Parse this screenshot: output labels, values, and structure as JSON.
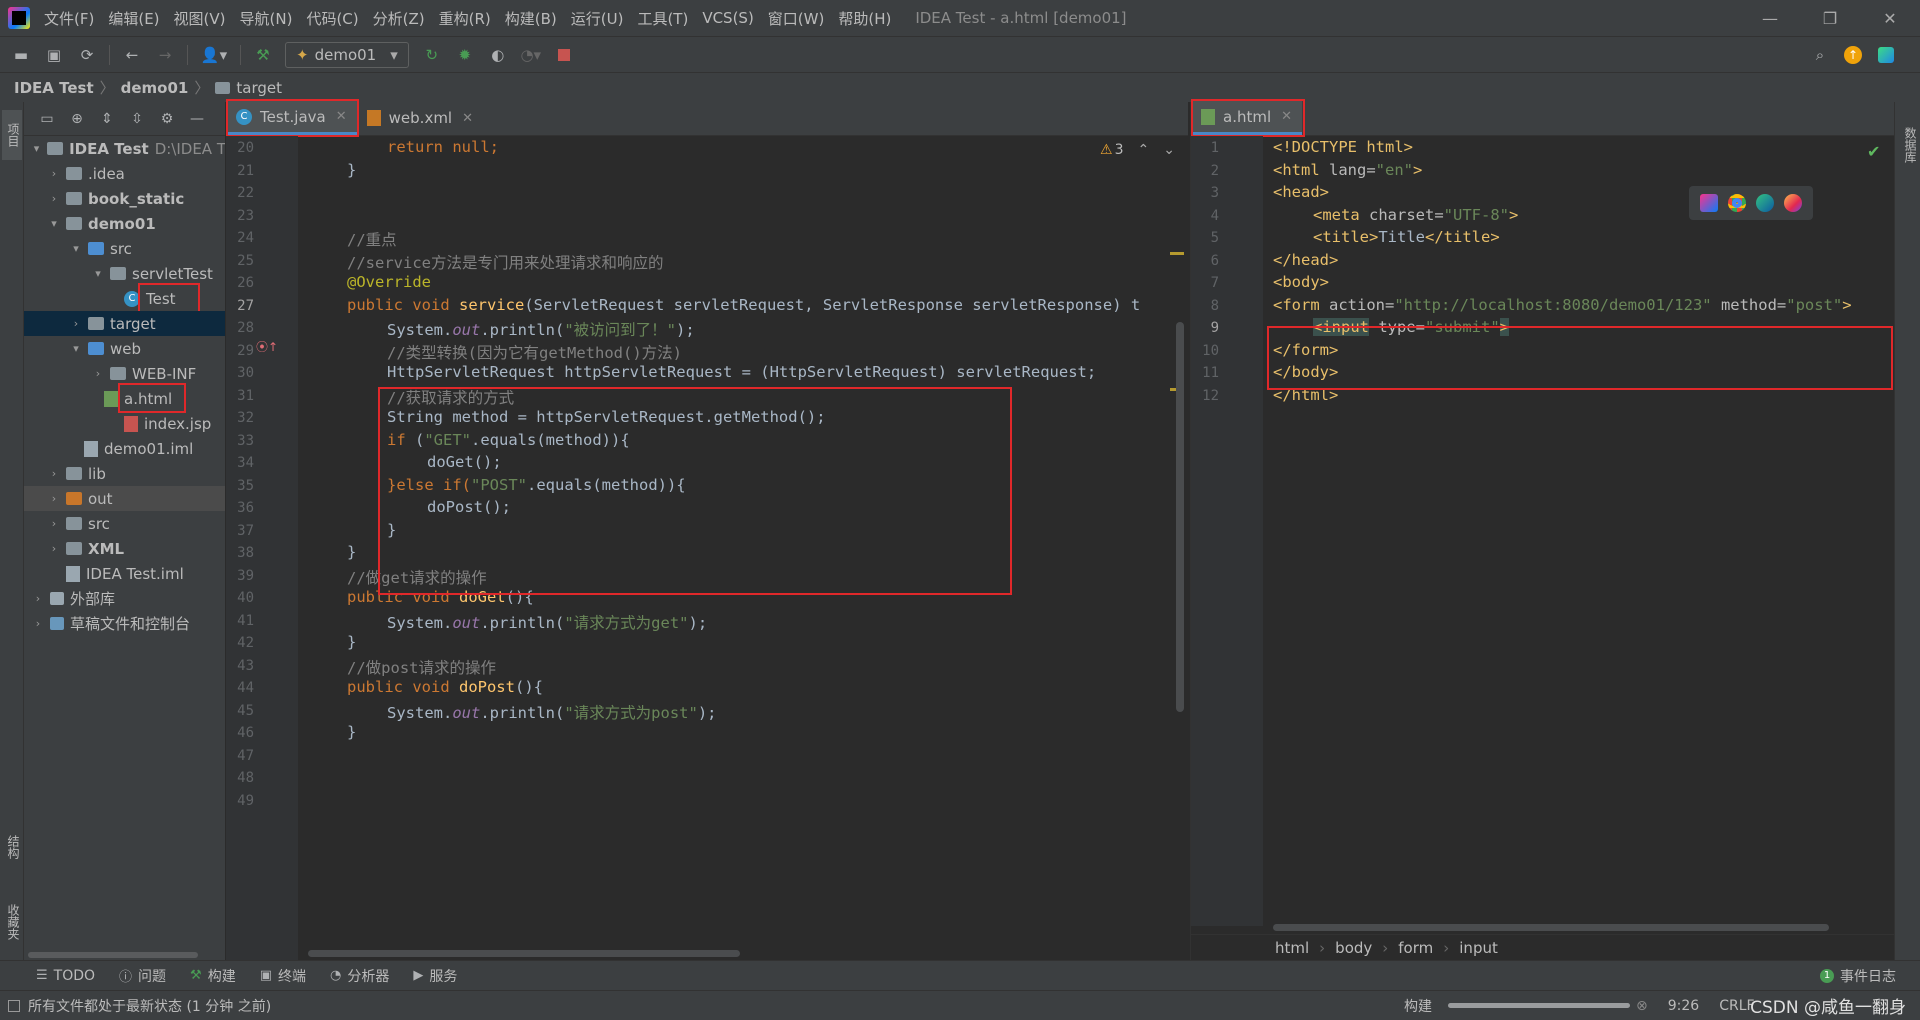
{
  "titlebar": {
    "menu": [
      "文件(F)",
      "编辑(E)",
      "视图(V)",
      "导航(N)",
      "代码(C)",
      "分析(Z)",
      "重构(R)",
      "构建(B)",
      "运行(U)",
      "工具(T)",
      "VCS(S)",
      "窗口(W)",
      "帮助(H)"
    ],
    "window_title": "IDEA Test - a.html [demo01]"
  },
  "toolbar": {
    "run_config": "demo01"
  },
  "breadcrumb": [
    "IDEA Test",
    "demo01",
    "target"
  ],
  "left_stripe": {
    "project": "项目",
    "structure": "结构",
    "favorites": "收藏夹"
  },
  "right_stripe": {
    "database": "数据库"
  },
  "project_tree": [
    {
      "label": "IDEA Test",
      "extra": "D:\\IDEA T",
      "bold": true
    },
    {
      "label": ".idea"
    },
    {
      "label": "book_static",
      "bold": true
    },
    {
      "label": "demo01",
      "bold": true
    },
    {
      "label": "src"
    },
    {
      "label": "servletTest"
    },
    {
      "label": "Test"
    },
    {
      "label": "target"
    },
    {
      "label": "web"
    },
    {
      "label": "WEB-INF"
    },
    {
      "label": "a.html"
    },
    {
      "label": "index.jsp"
    },
    {
      "label": "demo01.iml"
    },
    {
      "label": "lib"
    },
    {
      "label": "out"
    },
    {
      "label": "src"
    },
    {
      "label": "XML",
      "bold": true
    },
    {
      "label": "IDEA Test.iml"
    },
    {
      "label": "外部库"
    },
    {
      "label": "草稿文件和控制台"
    }
  ],
  "left_editor": {
    "tabs": [
      "Test.java",
      "web.xml"
    ],
    "inspection": "3",
    "line_numbers": [
      "20",
      "21",
      "22",
      "23",
      "24",
      "25",
      "26",
      "27",
      "28",
      "29",
      "30",
      "31",
      "32",
      "33",
      "34",
      "35",
      "36",
      "37",
      "38",
      "39",
      "40",
      "41",
      "42",
      "43",
      "44",
      "45",
      "46",
      "47",
      "48",
      "49"
    ],
    "code": {
      "l20": "return null;",
      "l21": "}",
      "l24": "//重点",
      "l25": "//service方法是专门用来处理请求和响应的",
      "l26": "@Override",
      "l27_kw": "public void ",
      "l27_fn": "service",
      "l27_rest": "(ServletRequest servletRequest, ServletResponse servletResponse) t",
      "l28_a": "System.",
      "l28_b": "out",
      "l28_c": ".println(",
      "l28_str": "\"被访问到了！\"",
      "l28_d": ");",
      "l29": "//类型转换(因为它有getMethod()方法)",
      "l30": "HttpServletRequest httpServletRequest = (HttpServletRequest) servletRequest;",
      "l31": "//获取请求的方式",
      "l32": "String method = httpServletRequest.getMethod();",
      "l33_kw": "if ",
      "l33_str": "\"GET\"",
      "l33_rest": ".equals(method)){",
      "l34": "doGet();",
      "l35_kw": "}else if(",
      "l35_str": "\"POST\"",
      "l35_rest": ".equals(method)){",
      "l36": "doPost();",
      "l37": "}",
      "l38": "}",
      "l39": "//做get请求的操作",
      "l40_fn": "doGet",
      "l41_str": "\"请求方式为get\"",
      "l42": "}",
      "l43": "//做post请求的操作",
      "l44_fn": "doPost",
      "l45_str": "\"请求方式为post\"",
      "l46": "}"
    }
  },
  "right_editor": {
    "tab": "a.html",
    "line_numbers": [
      "1",
      "2",
      "3",
      "4",
      "5",
      "6",
      "7",
      "8",
      "9",
      "10",
      "11",
      "12"
    ],
    "code": {
      "l1": "<!DOCTYPE html>",
      "l2_a": "<html ",
      "l2_b": "lang=",
      "l2_c": "\"en\"",
      "l2_d": ">",
      "l3": "<head>",
      "l4_a": "<meta ",
      "l4_b": "charset=",
      "l4_c": "\"UTF-8\"",
      "l4_d": ">",
      "l5_a": "<title>",
      "l5_b": "Title",
      "l5_c": "</title>",
      "l6": "</head>",
      "l7": "<body>",
      "l8_a": "<form ",
      "l8_b": "action=",
      "l8_c": "\"http://localhost:8080/demo01/123\"",
      "l8_d": " method=",
      "l8_e": "\"post\"",
      "l8_f": ">",
      "l9_a": "<input",
      "l9_b": " type=",
      "l9_c": "\"submit\"",
      "l9_d": ">",
      "l10": "</form>",
      "l11": "</body>",
      "l12": "</html>"
    },
    "breadcrumb": [
      "html",
      "body",
      "form",
      "input"
    ]
  },
  "bottom_tools": [
    "TODO",
    "问题",
    "构建",
    "终端",
    "分析器",
    "服务"
  ],
  "event_log": {
    "count": "1",
    "label": "事件日志"
  },
  "status": {
    "message": "所有文件都处于最新状态 (1 分钟 之前)",
    "build": "构建",
    "position": "9:26",
    "line_sep": "CRLF",
    "watermark": "CSDN @咸鱼一翻身"
  }
}
